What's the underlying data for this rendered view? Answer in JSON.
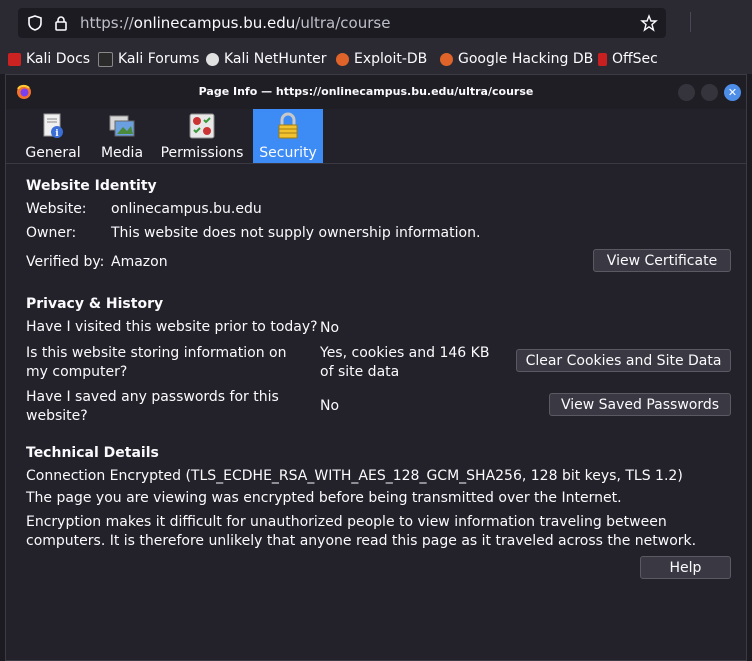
{
  "browser": {
    "url_prefix": "https://",
    "url_host": "onlinecampus.bu.edu",
    "url_path": "/ultra/course",
    "bookmarks": [
      "Kali Docs",
      "Kali Forums",
      "Kali NetHunter",
      "Exploit-DB",
      "Google Hacking DB",
      "OffSec"
    ]
  },
  "dialog": {
    "title": "Page Info — https://onlinecampus.bu.edu/ultra/course",
    "tabs": [
      {
        "label": "General",
        "icon": "info-page-icon"
      },
      {
        "label": "Media",
        "icon": "media-icon"
      },
      {
        "label": "Permissions",
        "icon": "permissions-icon"
      },
      {
        "label": "Security",
        "icon": "lock-icon",
        "active": true
      }
    ]
  },
  "identity": {
    "heading": "Website Identity",
    "website_label": "Website:",
    "website_value": "onlinecampus.bu.edu",
    "owner_label": "Owner:",
    "owner_value": "This website does not supply ownership information.",
    "verified_label": "Verified by:",
    "verified_value": "Amazon",
    "view_cert_label": "View Certificate"
  },
  "privacy": {
    "heading": "Privacy & History",
    "q1": "Have I visited this website prior to today?",
    "a1": "No",
    "q2": "Is this website storing information on my computer?",
    "a2": "Yes, cookies and 146 KB of site data",
    "clear_label": "Clear Cookies and Site Data",
    "q3": "Have I saved any passwords for this website?",
    "a3": "No",
    "saved_pw_label": "View Saved Passwords"
  },
  "technical": {
    "heading": "Technical Details",
    "line1": "Connection Encrypted (TLS_ECDHE_RSA_WITH_AES_128_GCM_SHA256, 128 bit keys, TLS 1.2)",
    "line2": "The page you are viewing was encrypted before being transmitted over the Internet.",
    "line3": "Encryption makes it difficult for unauthorized people to view information traveling between computers. It is therefore unlikely that anyone read this page as it traveled across the network."
  },
  "help_label": "Help",
  "colors": {
    "accent": "#3d8bf5",
    "background": "#23222b"
  }
}
